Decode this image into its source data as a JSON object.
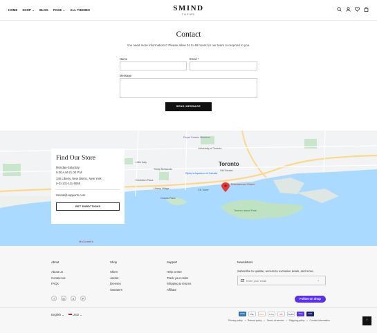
{
  "header": {
    "nav": [
      {
        "label": "HOME"
      },
      {
        "label": "SHOP",
        "caret": "⌄"
      },
      {
        "label": "BLOG"
      },
      {
        "label": "PAGE",
        "caret": "⌄"
      },
      {
        "label": "ALL THEMES"
      }
    ],
    "brand": "SMIND",
    "brand_sub": "THEME",
    "icons": [
      "search-icon",
      "account-icon",
      "wishlist-icon",
      "cart-icon"
    ]
  },
  "contact": {
    "title": "Contact",
    "subtitle": "You need more informations? Please allow 24 to 48 hours for our team to respond to you.",
    "name_label": "Name",
    "email_label": "Email *",
    "message_label": "Message",
    "send_label": "SEND MESSAGE"
  },
  "map": {
    "city_label": "Toronto",
    "place_labels": [
      "Royal Ontario Museum",
      "University of Toronto",
      "Ripley's Aquarium of Canada",
      "Toronto Island Park",
      "Entertainment District",
      "Little Italy",
      "Trinity Bellwoods",
      "Old Toronto",
      "Liberty Village",
      "Ontario Place",
      "Exhibition Place",
      "McDonald's",
      "CN Tower"
    ],
    "accent": "#aadaff"
  },
  "store": {
    "title": "Find Our Store",
    "hours_days": "Monday-Saturday",
    "hours_time": "9.00 A.M-21.00 P.M",
    "address": "330 Liberty, New Distric, New York",
    "phone": "(+0) 131-111-5555",
    "email": "Smind@supports.com",
    "directions_label": "GET DIRECTIONS"
  },
  "footer": {
    "about": {
      "head": "About",
      "items": [
        "About us",
        "Contact us",
        "FAQs"
      ]
    },
    "shop": {
      "head": "Shop",
      "items": [
        "Shirts",
        "Jacket",
        "Dresses",
        "Sweaters"
      ]
    },
    "support": {
      "head": "Support",
      "items": [
        "Help center",
        "Track your order",
        "Shipping & returns",
        "Affiliate"
      ]
    },
    "newsletter": {
      "head": "Newsletters",
      "text": "Subscribe to update, access to exclusive deals, and more.",
      "placeholder": "Enter your email"
    },
    "socials": [
      "f",
      "◎",
      "X",
      "P"
    ],
    "follow_label": "Follow on shop",
    "language": "English ⌄",
    "currency": "USD ⌄",
    "payments": [
      "AMEX",
      "Pay",
      "DISC",
      "G Pay",
      "MC",
      "PayPal",
      "Shop",
      "VISA"
    ],
    "legal": [
      "Privacy policy",
      "Refund policy",
      "Terms of service",
      "Shipping policy",
      "Contact information"
    ],
    "separator": "•"
  },
  "colors": {
    "accent": "#5a31f4",
    "dark": "#111111",
    "water": "#aadaff",
    "marker": "#e53935"
  }
}
